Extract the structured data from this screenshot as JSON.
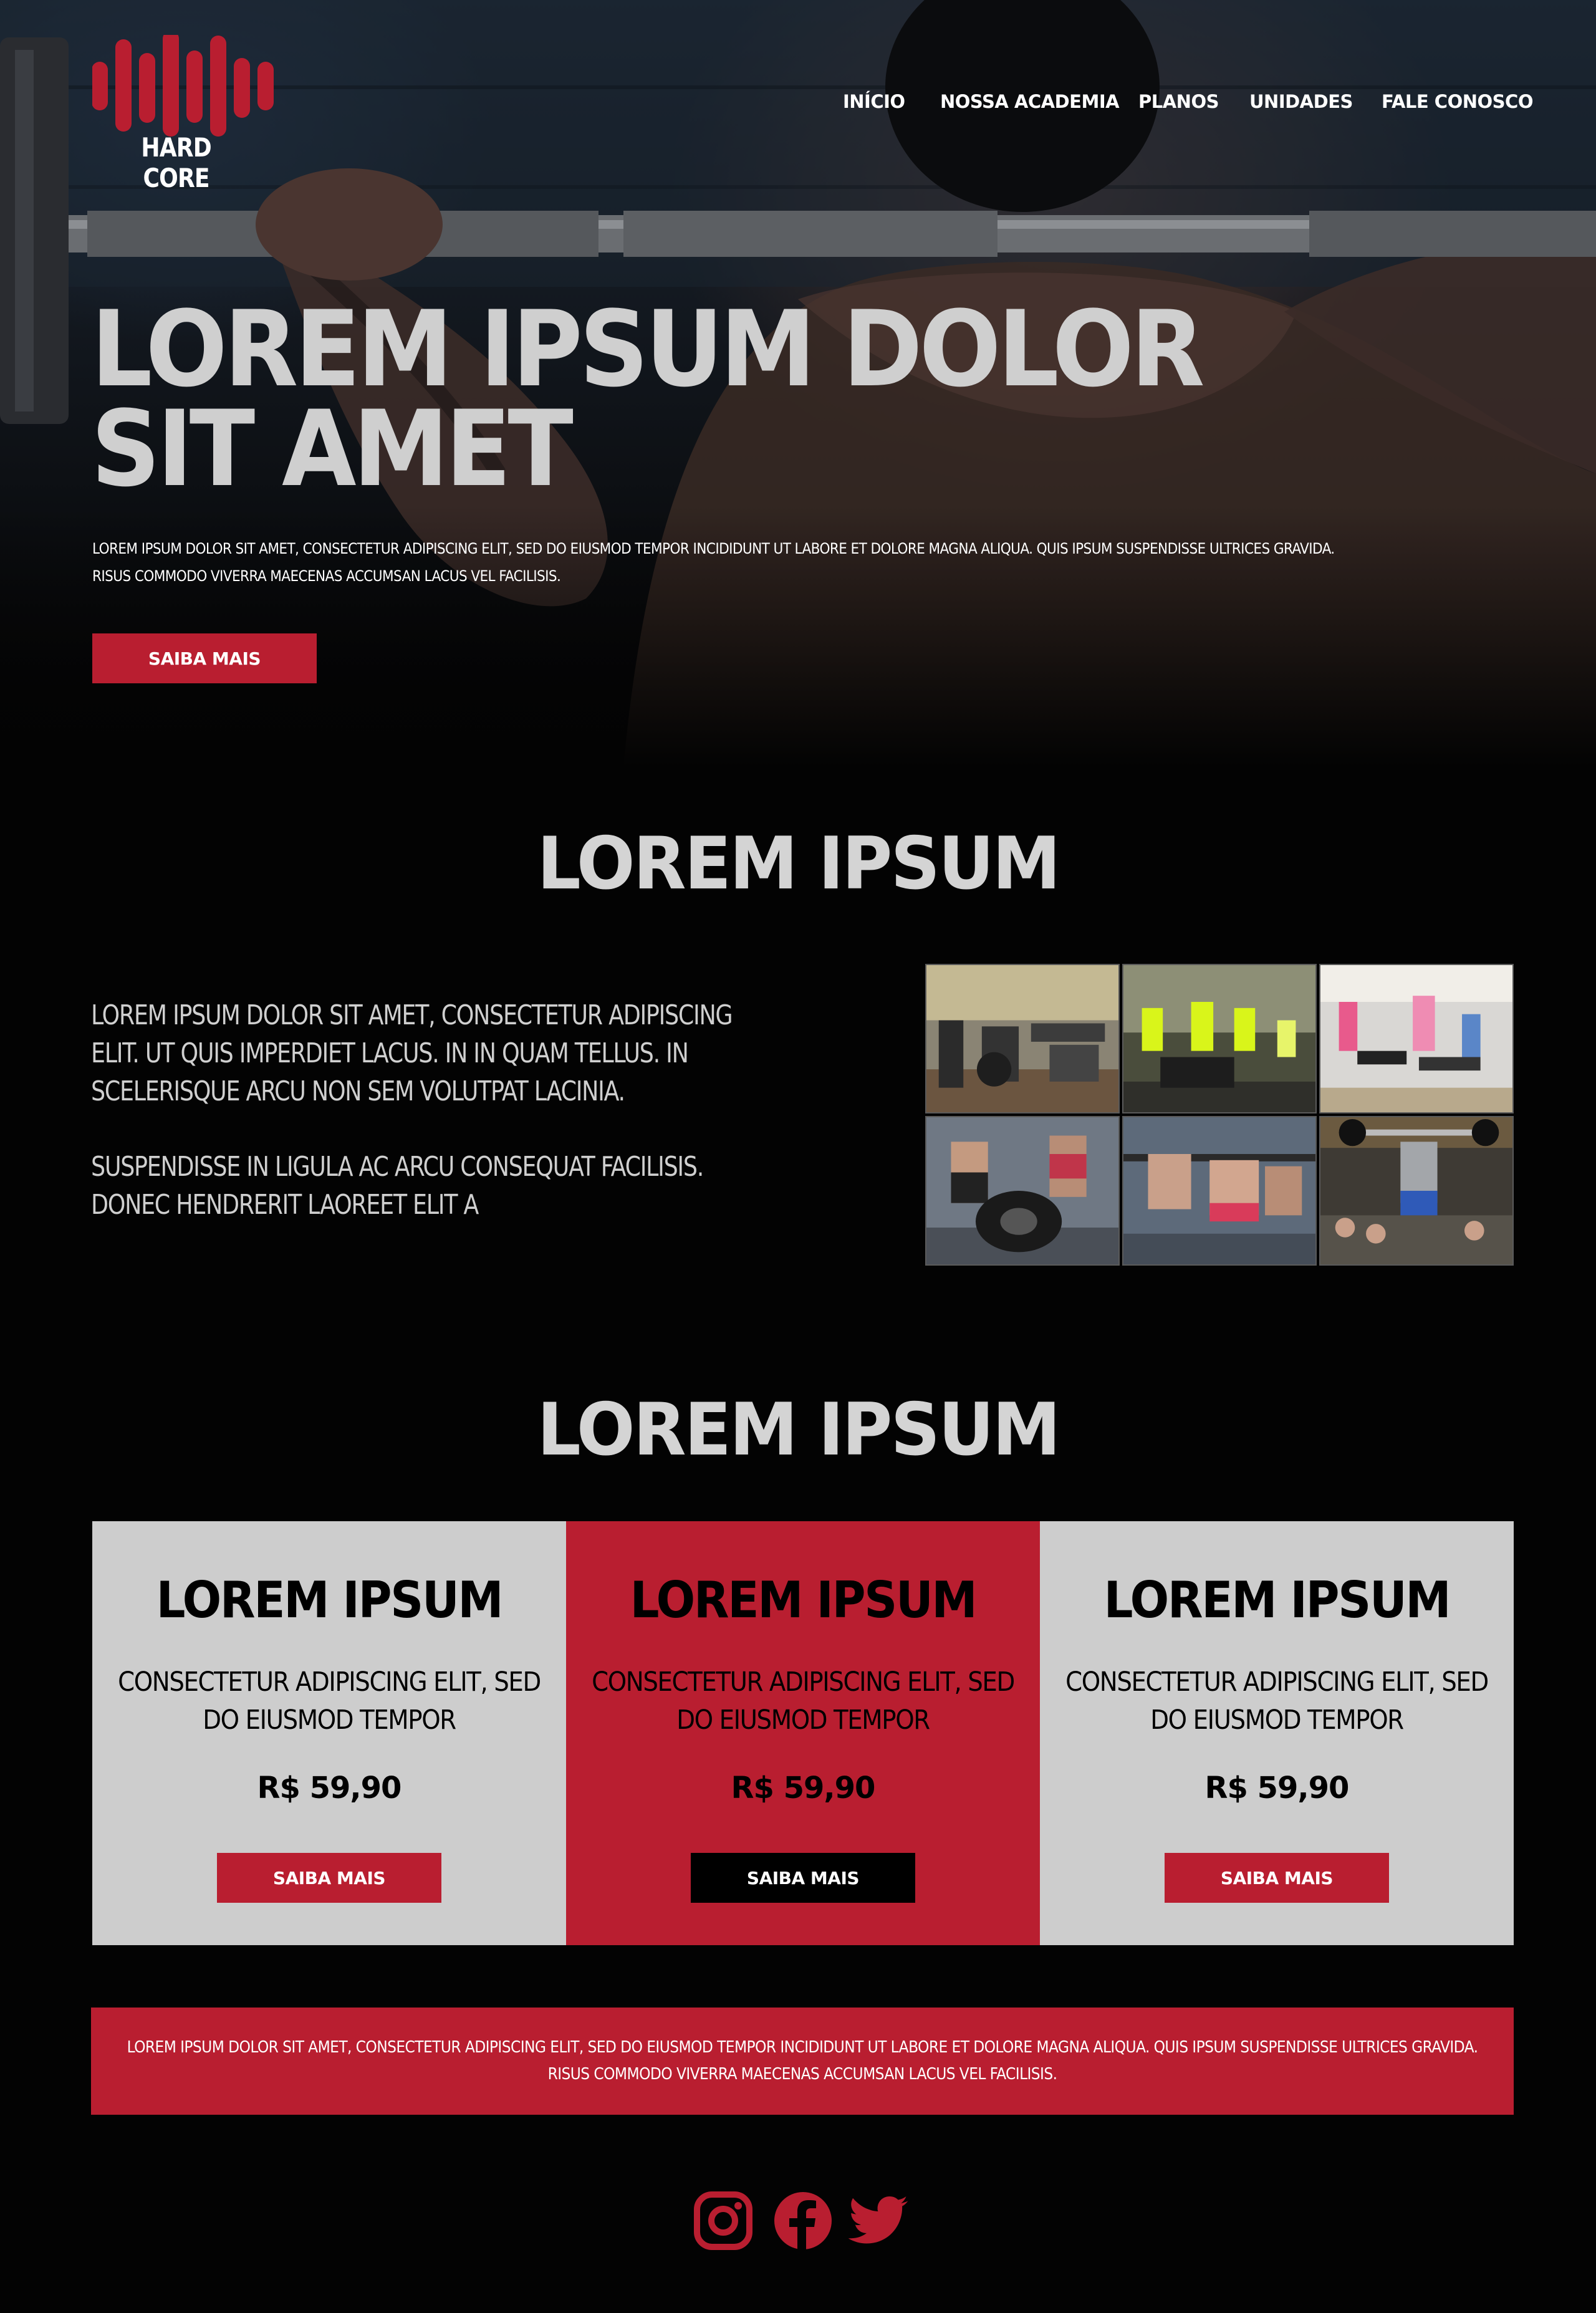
{
  "brand": {
    "name": "HARD CORE",
    "accent_color": "#b91e30"
  },
  "nav": {
    "items": [
      {
        "label": "INÍCIO"
      },
      {
        "label": "NOSSA ACADEMIA"
      },
      {
        "label": "PLANOS"
      },
      {
        "label": "UNIDADES"
      },
      {
        "label": "FALE CONOSCO"
      }
    ]
  },
  "hero": {
    "title": "LOREM IPSUM DOLOR SIT AMET",
    "text": "LOREM IPSUM DOLOR SIT AMET, CONSECTETUR ADIPISCING ELIT, SED DO EIUSMOD TEMPOR INCIDIDUNT UT LABORE ET DOLORE MAGNA ALIQUA. QUIS IPSUM SUSPENDISSE ULTRICES GRAVIDA. RISUS COMMODO VIVERRA MAECENAS ACCUMSAN LACUS VEL FACILISIS.",
    "button": "SAIBA MAIS"
  },
  "about": {
    "title": "LOREM IPSUM",
    "paragraphs": [
      "LOREM IPSUM DOLOR SIT AMET, CONSECTETUR ADIPISCING ELIT. UT QUIS IMPERDIET LACUS. IN IN QUAM TELLUS. IN SCELERISQUE ARCU NON SEM VOLUTPAT LACINIA.",
      "SUSPENDISSE IN LIGULA AC ARCU CONSEQUAT FACILISIS. DONEC HENDRERIT LAOREET ELIT A"
    ],
    "gallery": [
      {
        "icon": "gym-machines-photo"
      },
      {
        "icon": "trainers-group-photo"
      },
      {
        "icon": "aerobics-class-photo"
      },
      {
        "icon": "tire-flip-photo"
      },
      {
        "icon": "squat-class-photo"
      },
      {
        "icon": "overhead-lift-photo"
      }
    ]
  },
  "plans": {
    "title": "LOREM IPSUM",
    "items": [
      {
        "title": "LOREM IPSUM",
        "description": "CONSECTETUR ADIPISCING ELIT, SED DO EIUSMOD TEMPOR",
        "price": "R$ 59,90",
        "button": "SAIBA MAIS"
      },
      {
        "title": "LOREM IPSUM",
        "description": "CONSECTETUR ADIPISCING ELIT, SED DO EIUSMOD TEMPOR",
        "price": "R$ 59,90",
        "button": "SAIBA MAIS"
      },
      {
        "title": "LOREM IPSUM",
        "description": "CONSECTETUR ADIPISCING ELIT, SED DO EIUSMOD TEMPOR",
        "price": "R$ 59,90",
        "button": "SAIBA MAIS"
      }
    ]
  },
  "banner": {
    "text": "LOREM IPSUM DOLOR SIT AMET, CONSECTETUR ADIPISCING ELIT, SED DO EIUSMOD TEMPOR INCIDIDUNT UT LABORE ET DOLORE MAGNA ALIQUA. QUIS IPSUM SUSPENDISSE ULTRICES GRAVIDA. RISUS COMMODO VIVERRA MAECENAS ACCUMSAN LACUS VEL FACILISIS."
  },
  "social": [
    {
      "icon": "instagram-icon"
    },
    {
      "icon": "facebook-icon"
    },
    {
      "icon": "twitter-icon"
    }
  ]
}
